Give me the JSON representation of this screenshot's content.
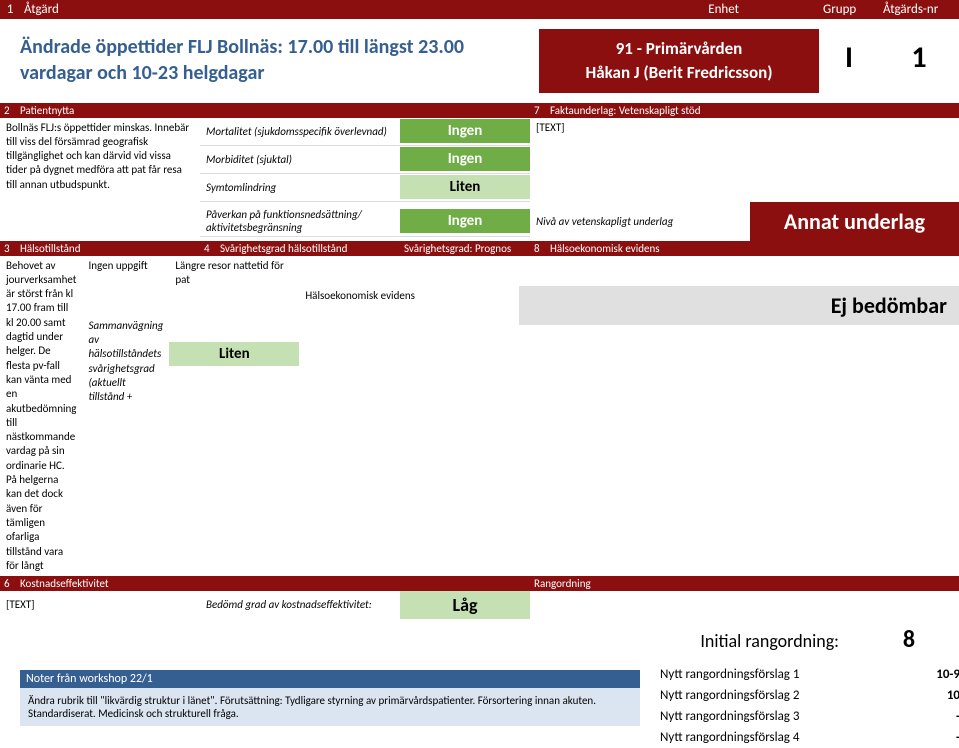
{
  "header": {
    "num_label": "1",
    "atgard": "Åtgärd",
    "enhet": "Enhet",
    "grupp": "Grupp",
    "atgnr": "Åtgärds-nr"
  },
  "title": "Ändrade öppettider FLJ Bollnäs: 17.00 till längst 23.00 vardagar och 10-23 helgdagar",
  "unit": {
    "line1": "91 - Primärvården",
    "line2": "Håkan J (Berit Fredricsson)"
  },
  "grupp_val": "I",
  "atgnr_val": "1",
  "s2": {
    "num": "2",
    "label": "Patientnytta",
    "text": "Bollnäs FLJ:s öppettider minskas. Innebär till viss del försämrad geografisk tillgänglighet och kan därvid vid vissa tider på dygnet medföra att pat får resa till annan utbudspunkt."
  },
  "s7": {
    "num": "7",
    "label": "Faktaunderlag: Vetenskapligt stöd",
    "text": "[TEXT]"
  },
  "metrics": {
    "m1_label": "Mortalitet (sjukdomsspecifik överlevnad)",
    "m1_val": "Ingen",
    "m2_label": "Morbiditet (sjuktal)",
    "m2_val": "Ingen",
    "m3_label": "Symtomlindring",
    "m3_val": "Liten",
    "m4_label": "Påverkan på funktionsnedsättning/ aktivitetsbegränsning",
    "m4_val": "Ingen"
  },
  "niva_label": "Nivå av vetenskapligt underlag",
  "badge_annat": "Annat underlag",
  "s3": {
    "num": "3",
    "label": "Hälsotillstånd",
    "text": "Behovet av jourverksamhet är störst från kl 17.00 fram till kl 20.00 samt dagtid under helger. De flesta pv-fall kan vänta med en akutbedömning till nästkommande vardag på sin ordinarie HC. På helgerna kan det dock även för tämligen ofarliga tillstånd vara för långt"
  },
  "s4": {
    "num": "4",
    "label": "Svårighetsgrad hälsotillstånd",
    "text": "Ingen uppgift",
    "samman_label": "Sammanvägning av hälsotillståndets svårighetsgrad (aktuellt tillstånd +",
    "samman_val": "Liten"
  },
  "prognos": {
    "label": "Svårighetsgrad: Prognos",
    "text": "Längre resor nattetid för pat"
  },
  "s8": {
    "num": "8",
    "label": "Hälsoekonomisk evidens",
    "sub_label": "Hälsoekonomisk evidens"
  },
  "badge_ej": "Ej bedömbar",
  "s6": {
    "num": "6",
    "label": "Kostnadseffektivitet",
    "text": "[TEXT]",
    "bedömd_label": "Bedömd grad av kostnadseffektivitet:",
    "bedömd_val": "Låg"
  },
  "rangordning_label": "Rangordning",
  "initial": {
    "label": "Initial rangordning:",
    "val": "8"
  },
  "notes": {
    "header": "Noter från workshop 22/1",
    "body": "Ändra rubrik till \"likvärdig struktur i länet\". Förutsättning: Tydligare styrning av primärvårdspatienter. Försortering innan akuten. Standardiserat. Medicinsk och strukturell fråga."
  },
  "proposals": [
    {
      "label": "Nytt rangordningsförslag 1",
      "val": "10-9"
    },
    {
      "label": "Nytt rangordningsförslag 2",
      "val": "10"
    },
    {
      "label": "Nytt rangordningsförslag 3",
      "val": "-"
    },
    {
      "label": "Nytt rangordningsförslag 4",
      "val": "-"
    }
  ]
}
